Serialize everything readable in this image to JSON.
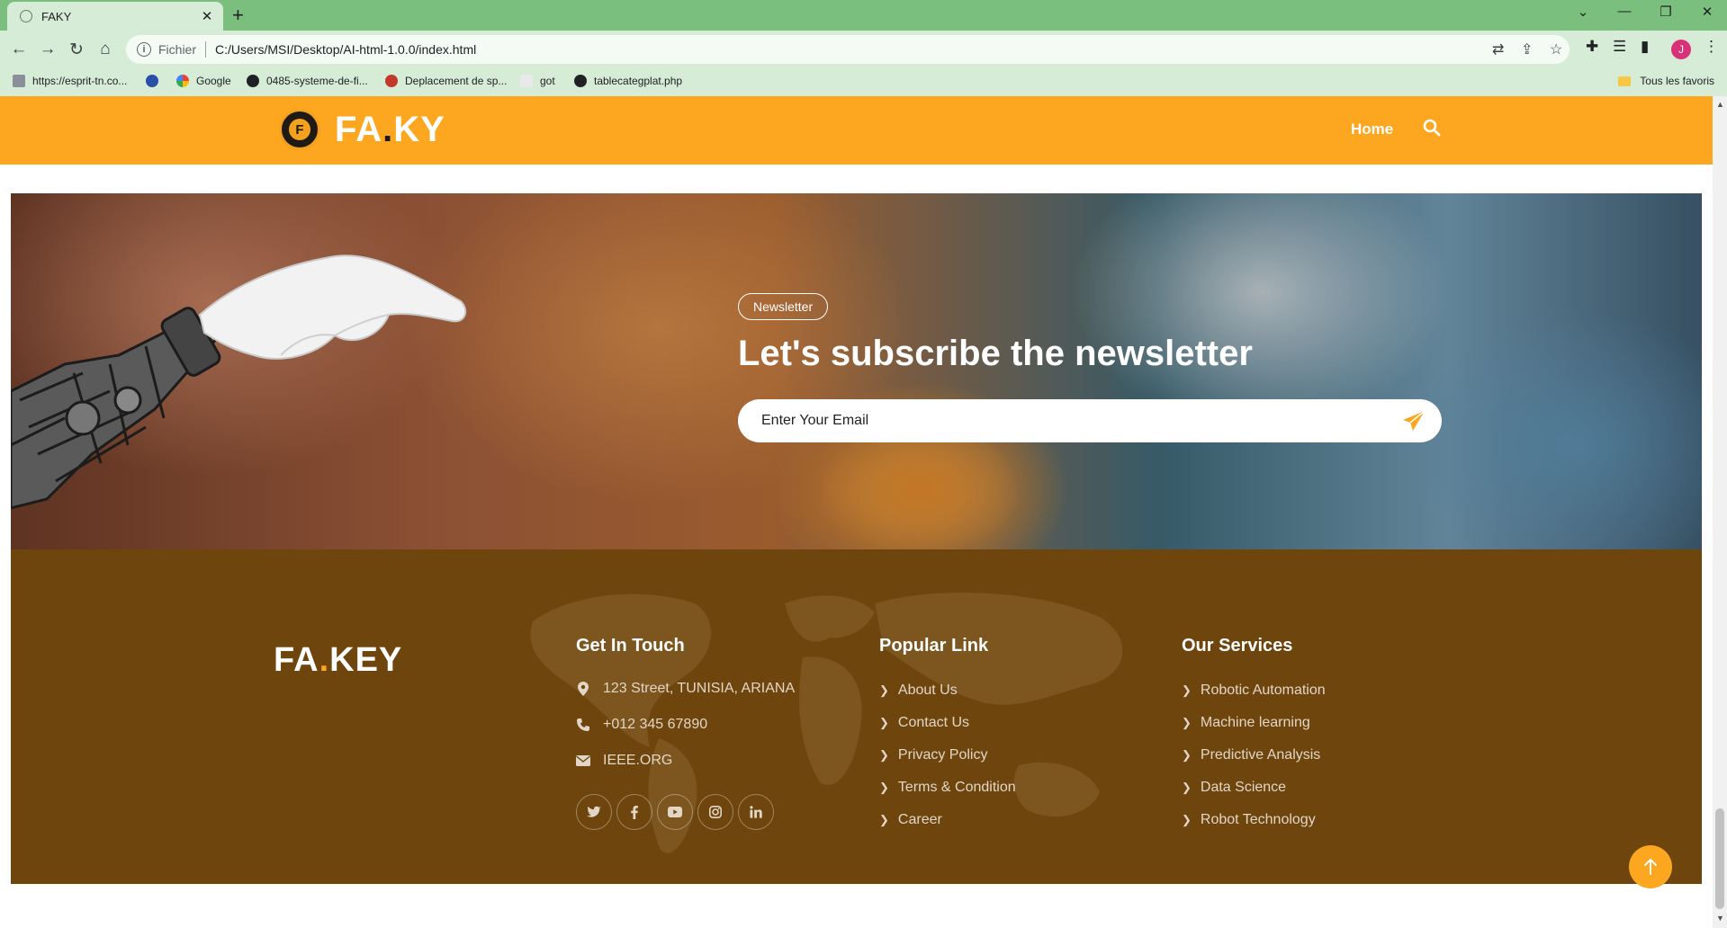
{
  "browser": {
    "tab_title": "FAKY",
    "url_scheme": "Fichier",
    "url": "C:/Users/MSI/Desktop/AI-html-1.0.0/index.html",
    "bookmarks": [
      "https://esprit-tn.co...",
      "Google",
      "0485-systeme-de-fi...",
      "Deplacement de sp...",
      "got",
      "tablecategplat.php"
    ],
    "all_bookmarks": "Tous les favoris",
    "profile_initial": "J"
  },
  "navbar": {
    "brand": "FA",
    "brand_dot": ".",
    "brand_end": "KY",
    "home": "Home"
  },
  "hero": {
    "badge": "Newsletter",
    "title": "Let's subscribe the newsletter",
    "email_placeholder": "Enter Your Email"
  },
  "footer": {
    "brand": "FA",
    "brand_dot": ".",
    "brand_end": "KEY",
    "contact": {
      "title": "Get In Touch",
      "address": "123 Street, TUNISIA, ARIANA",
      "phone": "+012 345 67890",
      "email": "IEEE.ORG"
    },
    "popular": {
      "title": "Popular Link",
      "links": [
        "About Us",
        "Contact Us",
        "Privacy Policy",
        "Terms & Condition",
        "Career"
      ]
    },
    "services": {
      "title": "Our Services",
      "links": [
        "Robotic Automation",
        "Machine learning",
        "Predictive Analysis",
        "Data Science",
        "Robot Technology"
      ]
    }
  },
  "colors": {
    "accent": "#fda61f",
    "footer_bg": "#6d450d",
    "browser_frame": "#7abf7e"
  },
  "icons": {
    "social": [
      "twitter-icon",
      "facebook-icon",
      "youtube-icon",
      "instagram-icon",
      "linkedin-icon"
    ]
  }
}
